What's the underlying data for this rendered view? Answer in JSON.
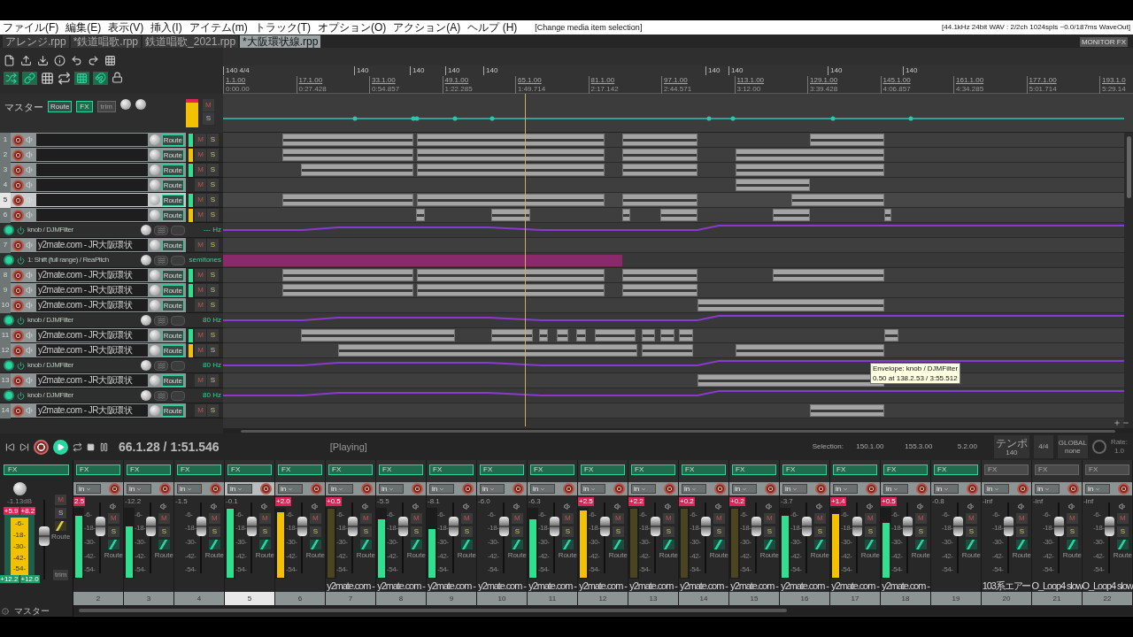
{
  "menu": [
    "ファイル(F)",
    "編集(E)",
    "表示(V)",
    "挿入(I)",
    "アイテム(m)",
    "トラック(T)",
    "オプション(O)",
    "アクション(A)",
    "ヘルプ (H)"
  ],
  "undo_hint": "[Change media item selection]",
  "audio_status": "[44.1kHz 24bit WAV : 2/2ch 1024spls ~0.0/187ms WaveOut]",
  "tabs": [
    {
      "label": "アレンジ.rpp",
      "selected": false
    },
    {
      "label": "*鉄道唱歌.rpp",
      "selected": false
    },
    {
      "label": "鉄道唱歌_2021.rpp",
      "selected": false
    },
    {
      "label": "*大阪環状線.rpp",
      "selected": true
    }
  ],
  "monitor_fx": "MONITOR FX",
  "master_track": {
    "name": "マスター",
    "route": "Route",
    "fx": "FX",
    "trim": "trim",
    "mute": "M",
    "solo": "S"
  },
  "ruler": {
    "tempo_markers": [
      "140 4/4",
      "140",
      "140",
      "140",
      "140",
      "140",
      "140",
      "140",
      "140"
    ],
    "bars": [
      {
        "bar": "1.1.00",
        "time": "0:00.00"
      },
      {
        "bar": "17.1.00",
        "time": "0:27.428"
      },
      {
        "bar": "33.1.00",
        "time": "0:54.857"
      },
      {
        "bar": "49.1.00",
        "time": "1:22.285"
      },
      {
        "bar": "65.1.00",
        "time": "1:49.714"
      },
      {
        "bar": "81.1.00",
        "time": "2:17.142"
      },
      {
        "bar": "97.1.00",
        "time": "2:44.571"
      },
      {
        "bar": "113.1.00",
        "time": "3:12.00"
      },
      {
        "bar": "129.1.00",
        "time": "3:39.428"
      },
      {
        "bar": "145.1.00",
        "time": "4:06.857"
      },
      {
        "bar": "161.1.00",
        "time": "4:34.285"
      },
      {
        "bar": "177.1.00",
        "time": "5:01.714"
      },
      {
        "bar": "193.1.0",
        "time": "5:29.14"
      }
    ]
  },
  "tracks": [
    {
      "kind": "track",
      "number": "1",
      "selected": false,
      "color": "#2ee08f",
      "route": "Route",
      "mute": "M",
      "solo": "S"
    },
    {
      "kind": "track",
      "number": "2",
      "selected": false,
      "color": "#f2c200",
      "route": "Route",
      "mute": "M",
      "solo": "S"
    },
    {
      "kind": "track",
      "number": "3",
      "selected": false,
      "color": "#2ee08f",
      "route": "Route",
      "mute": "M",
      "solo": "S"
    },
    {
      "kind": "track",
      "number": "4",
      "selected": false,
      "route": "Route",
      "mute": "M",
      "solo": "S"
    },
    {
      "kind": "track",
      "number": "5",
      "selected": true,
      "color": "#2ee08f",
      "route": "Route",
      "mute": "M",
      "solo": "S"
    },
    {
      "kind": "track",
      "number": "6",
      "selected": false,
      "color": "#f2c200",
      "route": "Route",
      "mute": "M",
      "solo": "S"
    },
    {
      "kind": "envelope",
      "name": "knob / DJMFilter",
      "value": "--- Hz"
    },
    {
      "kind": "track",
      "number": "7",
      "name": "y2mate.com - JR大阪環状",
      "selected": false,
      "route": "Route",
      "mute": "M",
      "solo": "S"
    },
    {
      "kind": "envelope",
      "name": "1: Shift (full range) / ReaPitch",
      "value": "semitones"
    },
    {
      "kind": "track",
      "number": "8",
      "name": "y2mate.com - JR大阪環状",
      "selected": false,
      "color": "#2ee08f",
      "route": "Route",
      "mute": "M",
      "solo": "S"
    },
    {
      "kind": "track",
      "number": "9",
      "name": "y2mate.com - JR大阪環状",
      "selected": false,
      "color": "#2ee08f",
      "route": "Route",
      "mute": "M",
      "solo": "S"
    },
    {
      "kind": "track",
      "number": "10",
      "name": "y2mate.com - JR大阪環状",
      "selected": false,
      "route": "Route",
      "mute": "M",
      "solo": "S"
    },
    {
      "kind": "envelope",
      "name": "knob / DJMFilter",
      "value": "80 Hz"
    },
    {
      "kind": "track",
      "number": "11",
      "name": "y2mate.com - JR大阪環状",
      "selected": false,
      "color": "#2ee08f",
      "route": "Route",
      "mute": "M",
      "solo": "S"
    },
    {
      "kind": "track",
      "number": "12",
      "name": "y2mate.com - JR大阪環状",
      "selected": false,
      "color": "#f2c200",
      "route": "Route",
      "mute": "M",
      "solo": "S"
    },
    {
      "kind": "envelope",
      "name": "knob / DJMFilter",
      "value": "80 Hz"
    },
    {
      "kind": "track",
      "number": "13",
      "name": "y2mate.com - JR大阪環状",
      "selected": false,
      "route": "Route",
      "mute": "M",
      "solo": "S"
    },
    {
      "kind": "envelope",
      "name": "knob / DJMFilter",
      "value": "80 Hz"
    },
    {
      "kind": "track",
      "number": "14",
      "name": "y2mate.com - JR大阪環状",
      "selected": false,
      "route": "Route",
      "mute": "M",
      "solo": "S"
    }
  ],
  "tooltip": [
    "Envelope: knob / DJMFilter",
    "0.50 at 138.2.53 / 3:55.512"
  ],
  "transport": {
    "position": "66.1.28 / 1:51.546",
    "state": "[Playing]",
    "selection_label": "Selection:",
    "selection": [
      "150.1.00",
      "155.3.00",
      "5.2.00"
    ],
    "tempo_label": "テンポ",
    "tempo": "140",
    "signature": "4/4",
    "global": "GLOBAL",
    "global_mode": "none",
    "rate_label": "Rate:",
    "rate": "1.0"
  },
  "mixer": {
    "master": {
      "fx": "FX",
      "gain": "-1.13dB",
      "peaks": [
        "+5.9",
        "+8.2"
      ],
      "holds": [
        "+12.2",
        "+12.0"
      ],
      "level": 0.95,
      "mute": "M",
      "solo": "S",
      "route": "Route",
      "trim": "trim",
      "name": "マスター",
      "scale": [
        "-6-",
        "-18-",
        "-30-",
        "-42-",
        "-54-"
      ]
    },
    "channels": [
      {
        "number": "2",
        "peak": "2.5",
        "clipped": true,
        "level": 0.9,
        "color": "#2ee08f",
        "selected": false,
        "fx_active": true,
        "fx": "FX",
        "input": "in",
        "mute": "M",
        "solo": "S",
        "route": "Route",
        "scale": [
          "-6-",
          "-18-",
          "-30-",
          "-42-",
          "-54-"
        ]
      },
      {
        "number": "3",
        "peak": "-12.2",
        "clipped": false,
        "level": 0.75,
        "color": "#2ee08f",
        "selected": false,
        "fx_active": true,
        "fx": "FX",
        "input": "in",
        "mute": "M",
        "solo": "S",
        "route": "Route",
        "scale": [
          "-6-",
          "-18-",
          "-30-",
          "-42-",
          "-54-"
        ]
      },
      {
        "number": "4",
        "peak": "-1.5",
        "clipped": false,
        "level": 0,
        "selected": false,
        "fx_active": true,
        "fx": "FX",
        "input": "in",
        "mute": "M",
        "solo": "S",
        "route": "Route",
        "scale": [
          "-6-",
          "-18-",
          "-30-",
          "-42-",
          "-54-"
        ]
      },
      {
        "number": "5",
        "peak": "-0.1",
        "clipped": false,
        "level": 1,
        "color": "#2ee08f",
        "selected": true,
        "fx_active": true,
        "fx": "FX",
        "input": "in",
        "mute": "M",
        "solo": "S",
        "route": "Route",
        "scale": [
          "-6-",
          "-18-",
          "-30-",
          "-42-",
          "-54-"
        ]
      },
      {
        "number": "6",
        "peak": "+2.0",
        "clipped": true,
        "level": 0.95,
        "color": "#f2c200",
        "selected": false,
        "fx_active": true,
        "fx": "FX",
        "input": "in",
        "mute": "M",
        "solo": "S",
        "route": "Route",
        "scale": [
          "-6-",
          "-18-",
          "-30-",
          "-42-",
          "-54-"
        ]
      },
      {
        "number": "7",
        "peak": "+0.5",
        "clipped": true,
        "level": 1,
        "color": "#4a4420",
        "name": "y2mate.com -",
        "selected": false,
        "fx_active": true,
        "fx": "FX",
        "input": "in",
        "mute": "M",
        "solo": "S",
        "route": "Route",
        "scale": [
          "-6-",
          "-18-",
          "-30-",
          "-42-",
          "-54-"
        ]
      },
      {
        "number": "8",
        "peak": "-5.5",
        "clipped": false,
        "level": 0.85,
        "color": "#2ee08f",
        "name": "y2mate.com -",
        "selected": false,
        "fx_active": true,
        "fx": "FX",
        "input": "in",
        "mute": "M",
        "solo": "S",
        "route": "Route",
        "scale": [
          "-6-",
          "-18-",
          "-30-",
          "-42-",
          "-54-"
        ]
      },
      {
        "number": "9",
        "peak": "-8.1",
        "clipped": false,
        "level": 0.7,
        "color": "#2ee08f",
        "name": "y2mate.com -",
        "selected": false,
        "fx_active": true,
        "fx": "FX",
        "input": "in",
        "mute": "M",
        "solo": "S",
        "route": "Route",
        "scale": [
          "-6-",
          "-18-",
          "-30-",
          "-42-",
          "-54-"
        ]
      },
      {
        "number": "10",
        "peak": "-6.0",
        "clipped": false,
        "level": 0,
        "name": "y2mate.com -",
        "selected": false,
        "fx_active": true,
        "fx": "FX",
        "input": "in",
        "mute": "M",
        "solo": "S",
        "route": "Route",
        "scale": [
          "-6-",
          "-18-",
          "-30-",
          "-42-",
          "-54-"
        ]
      },
      {
        "number": "11",
        "peak": "-6.3",
        "clipped": false,
        "level": 0.85,
        "color": "#2ee08f",
        "name": "y2mate.com -",
        "selected": false,
        "fx_active": true,
        "fx": "FX",
        "input": "in",
        "mute": "M",
        "solo": "S",
        "route": "Route",
        "scale": [
          "-6-",
          "-18-",
          "-30-",
          "-42-",
          "-54-"
        ]
      },
      {
        "number": "12",
        "peak": "+2.5",
        "clipped": true,
        "level": 0.97,
        "color": "#f2c200",
        "name": "y2mate.com -",
        "selected": false,
        "fx_active": true,
        "fx": "FX",
        "input": "in",
        "mute": "M",
        "solo": "S",
        "route": "Route",
        "scale": [
          "-6-",
          "-18-",
          "-30-",
          "-42-",
          "-54-"
        ]
      },
      {
        "number": "13",
        "peak": "+2.2",
        "clipped": true,
        "level": 1,
        "color": "#4a4420",
        "name": "y2mate.com -",
        "selected": false,
        "fx_active": true,
        "fx": "FX",
        "input": "in",
        "mute": "M",
        "solo": "S",
        "route": "Route",
        "scale": [
          "-6-",
          "-18-",
          "-30-",
          "-42-",
          "-54-"
        ]
      },
      {
        "number": "14",
        "peak": "+0.2",
        "clipped": true,
        "level": 1,
        "color": "#4a4420",
        "name": "y2mate.com -",
        "selected": false,
        "fx_active": true,
        "fx": "FX",
        "input": "in",
        "mute": "M",
        "solo": "S",
        "route": "Route",
        "scale": [
          "-6-",
          "-18-",
          "-30-",
          "-42-",
          "-54-"
        ]
      },
      {
        "number": "15",
        "peak": "+0.2",
        "clipped": true,
        "level": 1,
        "color": "#4a4420",
        "name": "y2mate.com -",
        "selected": false,
        "fx_active": true,
        "fx": "FX",
        "input": "in",
        "mute": "M",
        "solo": "S",
        "route": "Route",
        "scale": [
          "-6-",
          "-18-",
          "-30-",
          "-42-",
          "-54-"
        ]
      },
      {
        "number": "16",
        "peak": "-3.7",
        "clipped": false,
        "level": 0.9,
        "color": "#2ee08f",
        "name": "y2mate.com -",
        "selected": false,
        "fx_active": true,
        "fx": "FX",
        "input": "in",
        "mute": "M",
        "solo": "S",
        "route": "Route",
        "scale": [
          "-6-",
          "-18-",
          "-30-",
          "-42-",
          "-54-"
        ]
      },
      {
        "number": "17",
        "peak": "+1.4",
        "clipped": true,
        "level": 0.92,
        "color": "#f2c200",
        "name": "y2mate.com -",
        "selected": false,
        "fx_active": true,
        "fx": "FX",
        "input": "in",
        "mute": "M",
        "solo": "S",
        "route": "Route",
        "scale": [
          "-6-",
          "-18-",
          "-30-",
          "-42-",
          "-54-"
        ]
      },
      {
        "number": "18",
        "peak": "+0.5",
        "clipped": true,
        "level": 0.8,
        "color": "#2ee08f",
        "name": "y2mate.com -",
        "selected": false,
        "fx_active": true,
        "fx": "FX",
        "input": "in",
        "mute": "M",
        "solo": "S",
        "route": "Route",
        "scale": [
          "-6-",
          "-18-",
          "-30-",
          "-42-",
          "-54-"
        ]
      },
      {
        "number": "19",
        "peak": "-0.8",
        "clipped": false,
        "level": 0,
        "selected": false,
        "fx_active": true,
        "fx": "FX",
        "input": "in",
        "mute": "M",
        "solo": "S",
        "route": "Route",
        "scale": [
          "-6-",
          "-18-",
          "-30-",
          "-42-",
          "-54-"
        ]
      },
      {
        "number": "20",
        "peak": "-inf",
        "clipped": false,
        "level": 0,
        "name": "103系エアー",
        "selected": false,
        "fx_active": false,
        "fx": "FX",
        "input": "in",
        "mute": "M",
        "solo": "S",
        "route": "Route",
        "scale": [
          "-6-",
          "-18-",
          "-30-",
          "-42-",
          "-54-"
        ]
      },
      {
        "number": "21",
        "peak": "-inf",
        "clipped": false,
        "level": 0,
        "name": "O_Loop4 slow",
        "selected": false,
        "fx_active": false,
        "fx": "FX",
        "input": "in",
        "mute": "M",
        "solo": "S",
        "route": "Route",
        "scale": [
          "-6-",
          "-18-",
          "-30-",
          "-42-",
          "-54-"
        ]
      },
      {
        "number": "22",
        "peak": "-inf",
        "clipped": false,
        "level": 0,
        "name": "O_Loop4 slow",
        "selected": false,
        "fx_active": false,
        "fx": "FX",
        "input": "in",
        "mute": "M",
        "solo": "S",
        "route": "Route",
        "scale": [
          "-6-",
          "-18-",
          "-30-",
          "-42-",
          "-54-"
        ]
      }
    ]
  }
}
